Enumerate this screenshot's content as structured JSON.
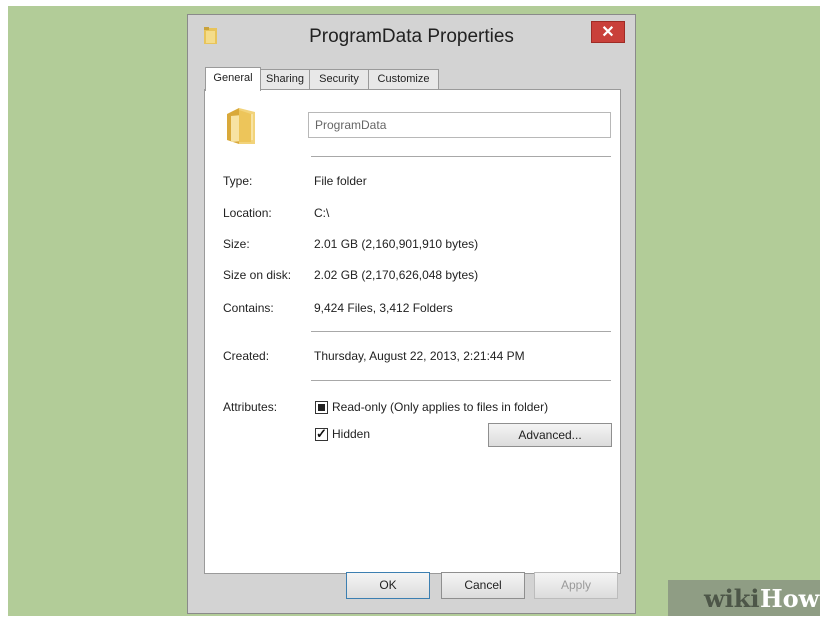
{
  "window": {
    "title": "ProgramData Properties",
    "close_glyph": "✕"
  },
  "tabs": [
    {
      "label": "General",
      "active": true
    },
    {
      "label": "Sharing",
      "active": false
    },
    {
      "label": "Security",
      "active": false
    },
    {
      "label": "Customize",
      "active": false
    }
  ],
  "general": {
    "folder_name": "ProgramData",
    "properties": [
      {
        "label": "Type:",
        "value": "File folder"
      },
      {
        "label": "Location:",
        "value": "C:\\"
      },
      {
        "label": "Size:",
        "value": "2.01 GB (2,160,901,910 bytes)"
      },
      {
        "label": "Size on disk:",
        "value": "2.02 GB (2,170,626,048 bytes)"
      },
      {
        "label": "Contains:",
        "value": "9,424 Files, 3,412 Folders"
      }
    ],
    "created": {
      "label": "Created:",
      "value": "Thursday, August 22, 2013, 2:21:44 PM"
    },
    "attributes": {
      "label": "Attributes:",
      "readonly": {
        "label": "Read-only (Only applies to files in folder)",
        "state": "indeterminate"
      },
      "hidden": {
        "label": "Hidden",
        "state": "checked"
      },
      "advanced_button": "Advanced..."
    }
  },
  "buttons": {
    "ok": "OK",
    "cancel": "Cancel",
    "apply": "Apply"
  },
  "watermark": {
    "part1": "wiki",
    "part2": "How"
  },
  "icons": {
    "title": "folder-icon",
    "folder": "folder-icon",
    "close": "close-icon"
  },
  "colors": {
    "background": "#b2cc98",
    "close_button": "#c9403a",
    "folder": "#e8c45a"
  }
}
